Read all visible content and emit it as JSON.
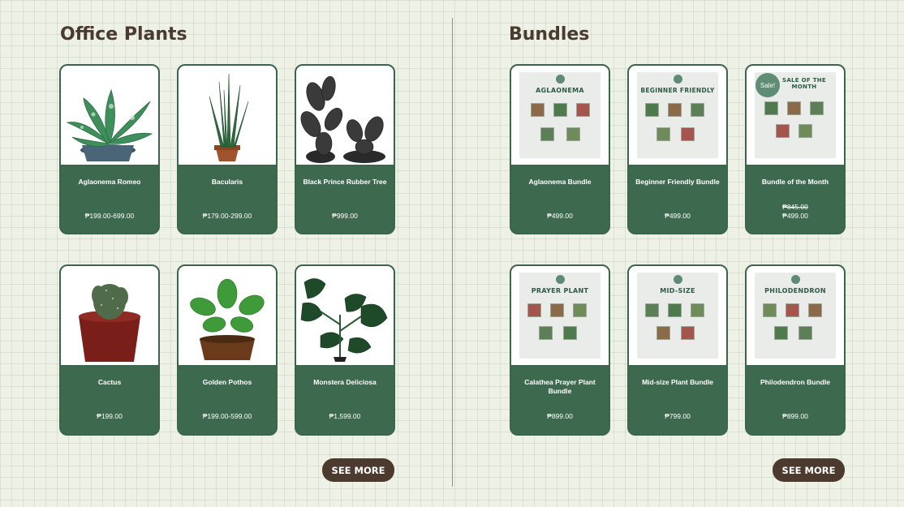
{
  "office": {
    "title": "Office Plants",
    "see_more": "SEE MORE",
    "products": [
      {
        "name": "Aglaonema Romeo",
        "price": "₱199.00-699.00"
      },
      {
        "name": "Bacularis",
        "price": "₱179.00-299.00"
      },
      {
        "name": "Black Prince Rubber Tree",
        "price": "₱999.00"
      },
      {
        "name": "Cactus",
        "price": "₱199.00"
      },
      {
        "name": "Golden Pothos",
        "price": "₱199.00-599.00"
      },
      {
        "name": "Monstera Deliciosa",
        "price": "₱1,599.00"
      }
    ]
  },
  "bundles": {
    "title": "Bundles",
    "see_more": "SEE MORE",
    "products": [
      {
        "name": "Aglaonema Bundle",
        "price": "₱499.00",
        "poster": "AGLAONEMA"
      },
      {
        "name": "Beginner Friendly Bundle",
        "price": "₱499.00",
        "poster": "BEGINNER FRIENDLY"
      },
      {
        "name": "Bundle of the Month",
        "old_price": "₱845.00",
        "price": "₱499.00",
        "poster": "SALE OF THE MONTH",
        "badge": "Sale!"
      },
      {
        "name": "Calathea Prayer Plant Bundle",
        "price": "₱899.00",
        "poster": "PRAYER PLANT"
      },
      {
        "name": "Mid-size Plant Bundle",
        "price": "₱799.00",
        "poster": "MID-SIZE"
      },
      {
        "name": "Philodendron Bundle",
        "price": "₱899.00",
        "poster": "PHILODENDRON"
      }
    ]
  },
  "colors": {
    "background": "#eef1e6",
    "card_green": "#3d6a4f",
    "title_brown": "#4a3b30",
    "button_brown": "#4d3a2e"
  }
}
